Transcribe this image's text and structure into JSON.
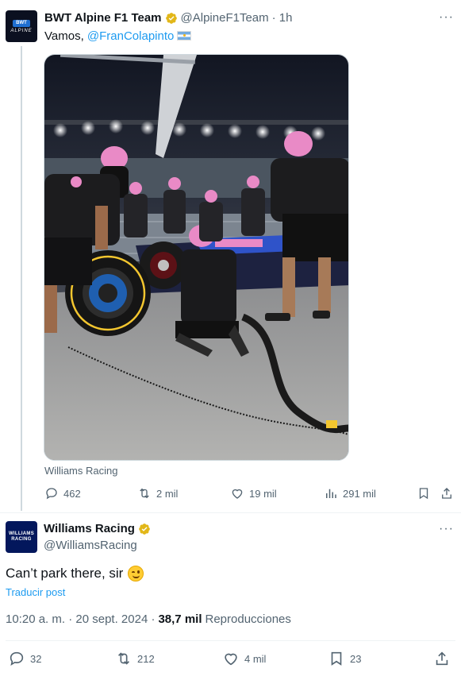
{
  "tweet1": {
    "name": "BWT Alpine F1 Team",
    "handle": "@AlpineF1Team",
    "time": "· 1h",
    "text_prefix": "Vamos, ",
    "mention": "@FranColapinto",
    "avatar": {
      "badge": "BWT",
      "word": "ALPINE"
    },
    "photo_caption": "Williams Racing",
    "actions": {
      "replies": "462",
      "reposts": "2 mil",
      "likes": "19 mil",
      "views": "291 mil"
    },
    "more_label": "···"
  },
  "tweet2": {
    "name": "Williams Racing",
    "handle": "@WilliamsRacing",
    "avatar": {
      "line1": "WILLIAMS",
      "line2": "RACING"
    },
    "text": "Can’t park there, sir",
    "translate": "Traducir post",
    "time": "10:20 a. m. · 20 sept. 2024 ·",
    "views_count": "38,7 mil",
    "views_label": "Reproducciones",
    "actions": {
      "replies": "32",
      "reposts": "212",
      "likes": "4 mil",
      "bookmarks": "23"
    },
    "more_label": "···"
  },
  "colors": {
    "accent": "#1d9bf0",
    "verified": "#e2b719",
    "text_secondary": "#536471",
    "alpine_pink": "#e98ac6"
  }
}
